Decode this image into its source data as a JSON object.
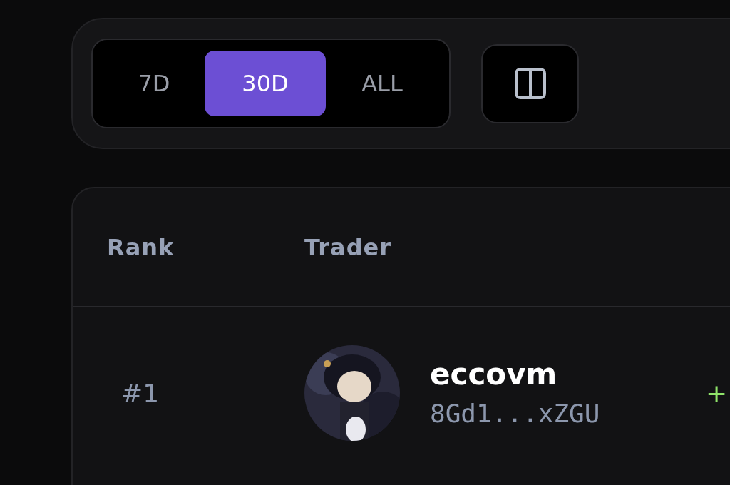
{
  "periods": [
    {
      "label": "7D",
      "selected": false
    },
    {
      "label": "30D",
      "selected": true
    },
    {
      "label": "ALL",
      "selected": false
    }
  ],
  "table": {
    "columns": [
      "Rank",
      "Trader"
    ],
    "rows": [
      {
        "rank": "#1",
        "name": "eccovm",
        "address": "8Gd1...xZGU",
        "column_3": "+"
      }
    ]
  }
}
